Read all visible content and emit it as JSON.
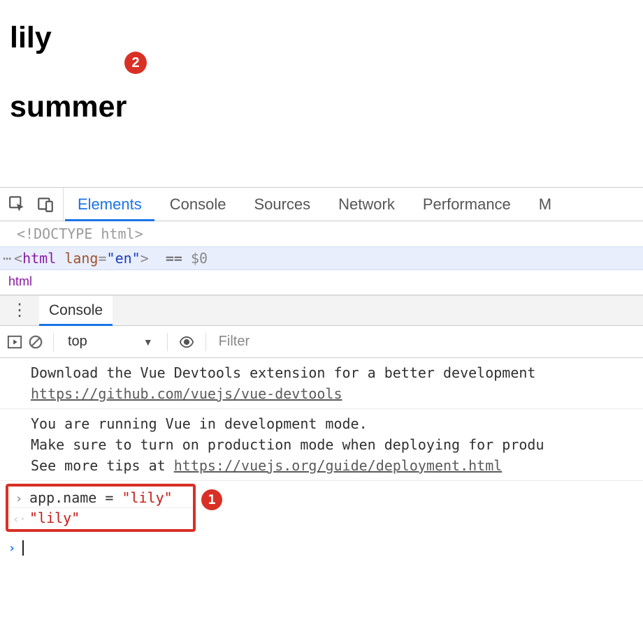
{
  "page": {
    "heading1": "lily",
    "heading2": "summer",
    "badge2": "2"
  },
  "devtools": {
    "tabs": [
      "Elements",
      "Console",
      "Sources",
      "Network",
      "Performance",
      "M"
    ],
    "activeTab": 0,
    "elements": {
      "doctype": "<!DOCTYPE html>",
      "tagOpen": "<",
      "tagName": "html",
      "attrName": "lang",
      "attrValue": "\"en\"",
      "tagClose": ">",
      "equals": "==",
      "selected": "$0",
      "breadcrumb": "html"
    }
  },
  "consoleDrawer": {
    "tabLabel": "Console",
    "toolbar": {
      "context": "top",
      "filterPlaceholder": "Filter"
    },
    "messages": [
      {
        "lines": [
          "Download the Vue Devtools extension for a better development "
        ],
        "link": "https://github.com/vuejs/vue-devtools"
      },
      {
        "lines": [
          "You are running Vue in development mode.",
          "Make sure to turn on production mode when deploying for produ"
        ],
        "tipPrefix": "See more tips at ",
        "tipLink": "https://vuejs.org/guide/deployment.html"
      }
    ],
    "promptInput": "app.name = \"lily\"",
    "promptResult": "\"lily\"",
    "badge1": "1"
  }
}
